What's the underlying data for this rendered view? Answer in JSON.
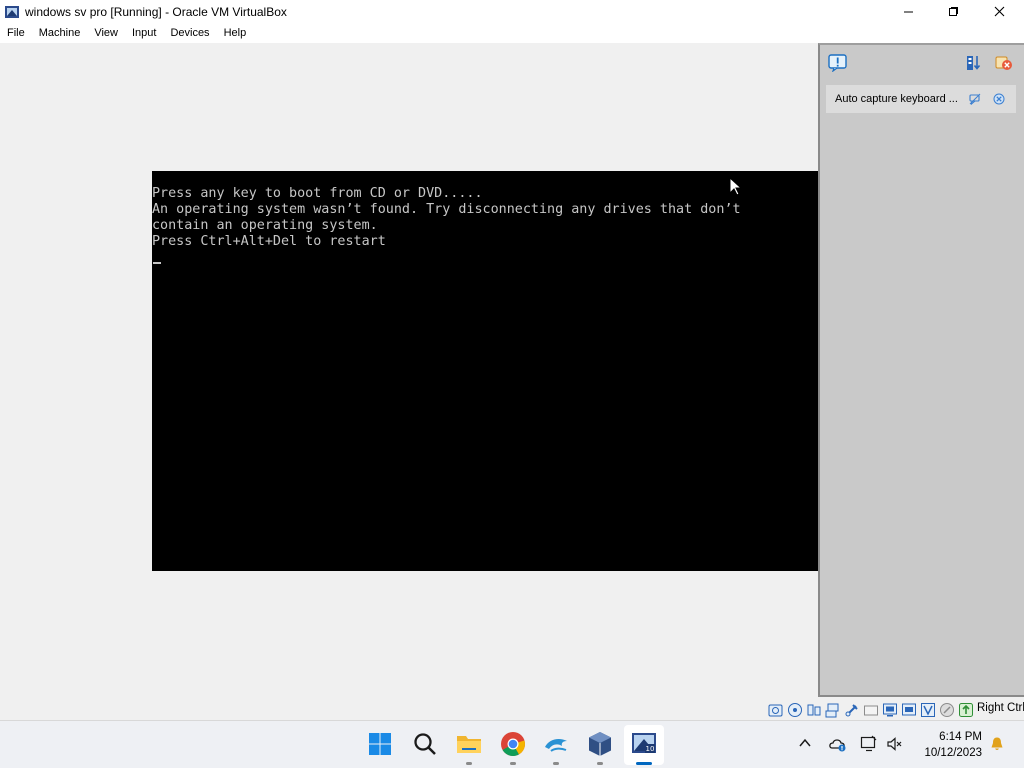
{
  "window": {
    "title": "windows  sv pro [Running] - Oracle VM VirtualBox",
    "icon": "virtualbox-icon",
    "controls": [
      "minimize-icon",
      "maximize-icon",
      "close-icon"
    ]
  },
  "menu": {
    "file": "File",
    "machine": "Machine",
    "view": "View",
    "input": "Input",
    "devices": "Devices",
    "help": "Help"
  },
  "console": {
    "line1": "Press any key to boot from CD or DVD.....",
    "line2": "An operating system wasn’t found. Try disconnecting any drives that don’t",
    "line3": "contain an operating system.",
    "line4": "Press Ctrl+Alt+Del to restart",
    "text_color": "#c6c6c6",
    "background": "#000000"
  },
  "notification_panel": {
    "message": "Auto capture keyboard ...",
    "icons": [
      "info-icon",
      "settings-icon",
      "close-all-icon",
      "hide-icon",
      "dismiss-icon"
    ]
  },
  "statusbar": {
    "host_key": "Right Ctrl",
    "icons": [
      "hard-disk-icon",
      "optical-drive-icon",
      "audio-icon",
      "network-icon",
      "usb-icon",
      "shared-folders-icon",
      "display-icon",
      "video-capture-icon",
      "cpu-icon",
      "mouse-integration-icon",
      "keyboard-icon"
    ]
  },
  "taskbar": {
    "apps": [
      "start-icon",
      "search-icon",
      "file-explorer-icon",
      "chrome-icon",
      "dolphin-icon",
      "virtualbox-manager-icon",
      "virtualbox-vm-icon"
    ],
    "time": "6:14 PM",
    "date": "10/12/2023"
  },
  "colors": {
    "accent": "#0067c0",
    "panel": "#c9c9c9"
  }
}
